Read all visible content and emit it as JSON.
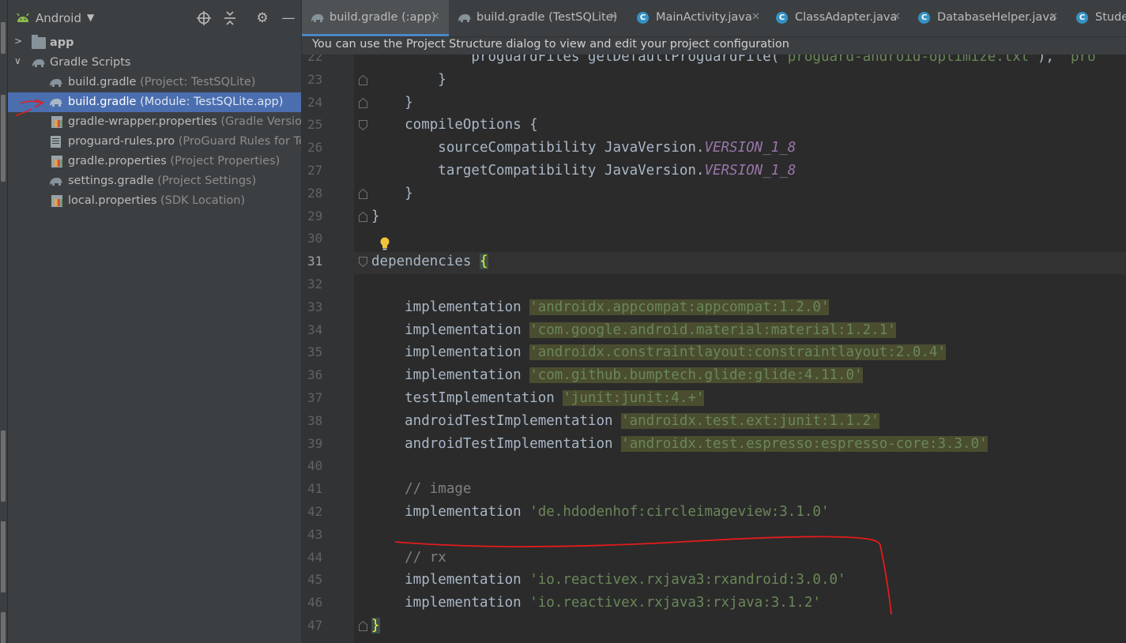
{
  "project_panel": {
    "view_selector": "Android",
    "tree": [
      {
        "label": "app",
        "hint": "",
        "bold": true,
        "icon": "folder-icon"
      },
      {
        "label": "Gradle Scripts",
        "hint": "",
        "icon": "gradle-elephant-icon"
      },
      {
        "label": "build.gradle",
        "hint": "(Project: TestSQLite)",
        "icon": "gradle-elephant-icon"
      },
      {
        "label": "build.gradle",
        "hint": "(Module: TestSQLite.app)",
        "icon": "gradle-elephant-icon",
        "selected": true
      },
      {
        "label": "gradle-wrapper.properties",
        "hint": "(Gradle Version)",
        "icon": "properties-file-icon"
      },
      {
        "label": "proguard-rules.pro",
        "hint": "(ProGuard Rules for TestS",
        "icon": "text-file-icon"
      },
      {
        "label": "gradle.properties",
        "hint": "(Project Properties)",
        "icon": "properties-file-icon"
      },
      {
        "label": "settings.gradle",
        "hint": "(Project Settings)",
        "icon": "gradle-elephant-icon"
      },
      {
        "label": "local.properties",
        "hint": "(SDK Location)",
        "icon": "properties-file-icon"
      }
    ]
  },
  "tabs": [
    {
      "label": "build.gradle (:app)",
      "icon": "gradle-elephant-icon",
      "active": true
    },
    {
      "label": "build.gradle (TestSQLite)",
      "icon": "gradle-elephant-icon"
    },
    {
      "label": "MainActivity.java",
      "icon": "java-class-icon"
    },
    {
      "label": "ClassAdapter.java",
      "icon": "java-class-icon"
    },
    {
      "label": "DatabaseHelper.java",
      "icon": "java-class-icon"
    },
    {
      "label": "Stude",
      "icon": "java-class-icon"
    }
  ],
  "notification": "You can use the Project Structure dialog to view and edit your project configuration",
  "editor": {
    "current_line": "31",
    "lines": [
      {
        "n": "22",
        "segs": [
          {
            "t": "            proguardFiles getDefaultProguardFile("
          },
          {
            "t": "'proguard-android-optimize.txt'",
            "c": "str"
          },
          {
            "t": "), "
          },
          {
            "t": "'pro",
            "c": "str"
          }
        ]
      },
      {
        "n": "23",
        "segs": [
          {
            "t": "        }"
          }
        ]
      },
      {
        "n": "24",
        "segs": [
          {
            "t": "    }"
          }
        ]
      },
      {
        "n": "25",
        "segs": [
          {
            "t": "    compileOptions {"
          }
        ]
      },
      {
        "n": "26",
        "segs": [
          {
            "t": "        sourceCompatibility JavaVersion."
          },
          {
            "t": "VERSION_1_8",
            "c": "const"
          }
        ]
      },
      {
        "n": "27",
        "segs": [
          {
            "t": "        targetCompatibility JavaVersion."
          },
          {
            "t": "VERSION_1_8",
            "c": "const"
          }
        ]
      },
      {
        "n": "28",
        "segs": [
          {
            "t": "    }"
          }
        ]
      },
      {
        "n": "29",
        "segs": [
          {
            "t": "}"
          }
        ]
      },
      {
        "n": "30",
        "segs": [
          {
            "t": ""
          }
        ]
      },
      {
        "n": "31",
        "segs": [
          {
            "t": "dependencies "
          },
          {
            "t": "{",
            "c": "brace-hl"
          }
        ]
      },
      {
        "n": "32",
        "segs": [
          {
            "t": ""
          }
        ]
      },
      {
        "n": "33",
        "segs": [
          {
            "t": "    implementation "
          },
          {
            "t": "'androidx.appcompat:appcompat:1.2.0'",
            "c": "str hl"
          }
        ]
      },
      {
        "n": "34",
        "segs": [
          {
            "t": "    implementation "
          },
          {
            "t": "'com.google.android.material:material:1.2.1'",
            "c": "str hl"
          }
        ]
      },
      {
        "n": "35",
        "segs": [
          {
            "t": "    implementation "
          },
          {
            "t": "'androidx.constraintlayout:constraintlayout:2.0.4'",
            "c": "str hl"
          }
        ]
      },
      {
        "n": "36",
        "segs": [
          {
            "t": "    implementation "
          },
          {
            "t": "'com.github.bumptech.glide:glide:4.11.0'",
            "c": "str hl"
          }
        ]
      },
      {
        "n": "37",
        "segs": [
          {
            "t": "    testImplementation "
          },
          {
            "t": "'junit:junit:4.+'",
            "c": "str hl"
          }
        ]
      },
      {
        "n": "38",
        "segs": [
          {
            "t": "    androidTestImplementation "
          },
          {
            "t": "'androidx.test.ext:junit:1.1.2'",
            "c": "str hl"
          }
        ]
      },
      {
        "n": "39",
        "segs": [
          {
            "t": "    androidTestImplementation "
          },
          {
            "t": "'androidx.test.espresso:espresso-core:3.3.0'",
            "c": "str hl"
          }
        ]
      },
      {
        "n": "40",
        "segs": [
          {
            "t": ""
          }
        ]
      },
      {
        "n": "41",
        "segs": [
          {
            "t": "    "
          },
          {
            "t": "// image",
            "c": "cmt"
          }
        ]
      },
      {
        "n": "42",
        "segs": [
          {
            "t": "    implementation "
          },
          {
            "t": "'de.hdodenhof:circleimageview:3.1.0'",
            "c": "str"
          }
        ]
      },
      {
        "n": "43",
        "segs": [
          {
            "t": ""
          }
        ]
      },
      {
        "n": "44",
        "segs": [
          {
            "t": "    "
          },
          {
            "t": "// rx",
            "c": "cmt"
          }
        ]
      },
      {
        "n": "45",
        "segs": [
          {
            "t": "    implementation "
          },
          {
            "t": "'io.reactivex.rxjava3:rxandroid:3.0.0'",
            "c": "str"
          }
        ]
      },
      {
        "n": "46",
        "segs": [
          {
            "t": "    implementation "
          },
          {
            "t": "'io.reactivex.rxjava3:rxjava:3.1.2'",
            "c": "str"
          }
        ]
      },
      {
        "n": "47",
        "segs": [
          {
            "t": "}",
            "c": "brace-hl"
          }
        ]
      }
    ]
  },
  "colors": {
    "accent": "#4a88c7",
    "selection": "#4b6eaf",
    "annotation": "#e51b1b"
  }
}
